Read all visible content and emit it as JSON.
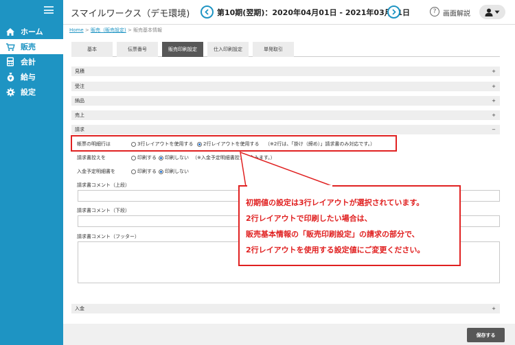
{
  "app": {
    "title": "スマイルワークス（デモ環境)"
  },
  "period": {
    "label": "第10期(翌期)：2020年04月01日 - 2021年03月31日"
  },
  "header": {
    "help_label": "画面解説",
    "help_glyph": "?"
  },
  "sidebar": {
    "items": [
      {
        "label": "ホーム",
        "icon": "home-icon"
      },
      {
        "label": "販売",
        "icon": "cart-icon"
      },
      {
        "label": "会計",
        "icon": "calculator-icon"
      },
      {
        "label": "給与",
        "icon": "money-bag-icon"
      },
      {
        "label": "設定",
        "icon": "gear-icon"
      }
    ]
  },
  "breadcrumb": {
    "home": "Home",
    "sep1": " > ",
    "sales_settings": "販売（販売設定)",
    "sep2": " > ",
    "current": "販売基本情報"
  },
  "tabs": [
    {
      "label": "基本"
    },
    {
      "label": "伝票番号"
    },
    {
      "label": "販売印刷設定"
    },
    {
      "label": "仕入印刷設定"
    },
    {
      "label": "単発取引"
    }
  ],
  "sections": {
    "estimate": "見積",
    "order": "受注",
    "delivery": "納品",
    "sales": "売上",
    "invoice": "請求",
    "payment": "入金",
    "plus": "+",
    "minus": "−"
  },
  "invoice": {
    "detail_row_label": "帳票の明細行は",
    "option_3row": "3行レイアウトを使用する",
    "option_2row": "2行レイアウトを使用する",
    "option_2row_note": "（※2行は、「掛け（締め）」請求書のみ対応です。）",
    "copy_label": "請求書控えを",
    "print": "印刷する",
    "no_print": "印刷しない",
    "copy_note": "（※入金予定明細書控えも含みます。）",
    "payment_schedule_label": "入金予定明細書を",
    "comment_top_label": "請求書コメント（上段）",
    "comment_bottom_label": "請求書コメント（下段）",
    "comment_footer_label": "請求書コメント（フッター）",
    "comment_top_value": "",
    "comment_bottom_value": "",
    "comment_footer_value": ""
  },
  "callout": {
    "line1": "初期値の設定は3行レイアウトが選択されています。",
    "line2": "2行レイアウトで印刷したい場合は、",
    "line3": "販売基本情報の「販売印刷設定」の請求の部分で、",
    "line4": "2行レイアウトを使用する設定値にご変更ください。"
  },
  "footer": {
    "save_label": "保存する"
  },
  "colors": {
    "accent": "#1e94c3",
    "annotation": "#e02020",
    "active_tab": "#575757"
  }
}
